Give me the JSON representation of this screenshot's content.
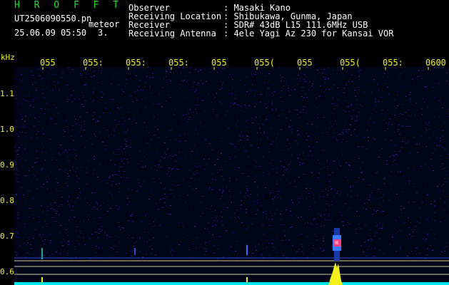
{
  "header": {
    "brand": "H R O F F T",
    "file_name": "UT2506090550.pn",
    "detect_label": "meteor",
    "datetime": "25.06.09 05:50",
    "count": "3."
  },
  "info": [
    {
      "label": "Observer",
      "value": ": Masaki Kano"
    },
    {
      "label": "Receiving Location",
      "value": ": Shibukawa, Gunma, Japan"
    },
    {
      "label": "Receiver",
      "value": ": SDR# 43dB L15 111.6MHz USB"
    },
    {
      "label": "Receiving Antenna",
      "value": ": 4ele Yagi Az 230 for Kansai VOR"
    }
  ],
  "axis": {
    "unit": "kHz",
    "time_ticks": [
      "055",
      "055:",
      "055:",
      "055:",
      "055",
      "055(",
      "055",
      "055(",
      "055:",
      "0600"
    ],
    "freq_ticks": [
      "1.1",
      "1.0",
      "0.9",
      "0.8",
      "0.7",
      "0.6"
    ]
  },
  "colors": {
    "brand": "#19e619",
    "text": "#ffffff",
    "axis": "#f0f020",
    "background": "#000000",
    "noise": "#1a2a8c",
    "echo_core": "#ff4080",
    "echo_outer": "#3a7aff",
    "baseline": "#00e5e5",
    "power_peak": "#f2f21a"
  }
}
